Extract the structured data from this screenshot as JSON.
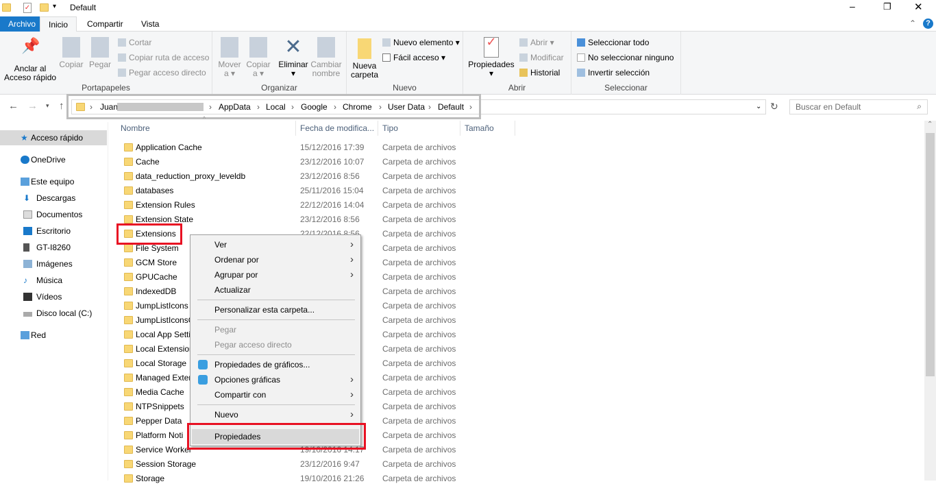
{
  "window": {
    "title": "Default",
    "help": "?"
  },
  "tabs": [
    "Archivo",
    "Inicio",
    "Compartir",
    "Vista"
  ],
  "ribbon": {
    "portapapeles": {
      "label": "Portapapeles",
      "anclar": "Anclar al\nAcceso rápido",
      "copiar": "Copiar",
      "pegar": "Pegar",
      "cortar": "Cortar",
      "copiar_ruta": "Copiar ruta de acceso",
      "pegar_acceso": "Pegar acceso directo"
    },
    "organizar": {
      "label": "Organizar",
      "mover": "Mover\na ▾",
      "copiar_a": "Copiar\na ▾",
      "eliminar": "Eliminar\n▾",
      "cambiar": "Cambiar\nnombre"
    },
    "nuevo": {
      "label": "Nuevo",
      "carpeta": "Nueva\ncarpeta",
      "elemento": "Nuevo elemento ▾",
      "facil": "Fácil acceso ▾"
    },
    "abrir": {
      "label": "Abrir",
      "propiedades": "Propiedades\n▾",
      "abrir": "Abrir ▾",
      "modificar": "Modificar",
      "historial": "Historial"
    },
    "seleccionar": {
      "label": "Seleccionar",
      "todo": "Seleccionar todo",
      "ninguno": "No seleccionar ninguno",
      "invertir": "Invertir selección"
    }
  },
  "address": {
    "crumbs": [
      "Juan",
      "AppData",
      "Local",
      "Google",
      "Chrome",
      "User Data",
      "Default"
    ]
  },
  "search": {
    "placeholder": "Buscar en Default"
  },
  "nav": [
    "Acceso rápido",
    "OneDrive",
    "Este equipo",
    "Descargas",
    "Documentos",
    "Escritorio",
    "GT-I8260",
    "Imágenes",
    "Música",
    "Vídeos",
    "Disco local (C:)",
    "Red"
  ],
  "columns": [
    "Nombre",
    "Fecha de modifica...",
    "Tipo",
    "Tamaño"
  ],
  "files": [
    {
      "n": "Application Cache",
      "d": "15/12/2016 17:39",
      "t": "Carpeta de archivos"
    },
    {
      "n": "Cache",
      "d": "23/12/2016 10:07",
      "t": "Carpeta de archivos"
    },
    {
      "n": "data_reduction_proxy_leveldb",
      "d": "23/12/2016 8:56",
      "t": "Carpeta de archivos"
    },
    {
      "n": "databases",
      "d": "25/11/2016 15:04",
      "t": "Carpeta de archivos"
    },
    {
      "n": "Extension Rules",
      "d": "22/12/2016 14:04",
      "t": "Carpeta de archivos"
    },
    {
      "n": "Extension State",
      "d": "23/12/2016 8:56",
      "t": "Carpeta de archivos"
    },
    {
      "n": "Extensions",
      "d": "22/12/2016 8:56",
      "t": "Carpeta de archivos"
    },
    {
      "n": "File System",
      "d": "",
      "t": "Carpeta de archivos"
    },
    {
      "n": "GCM Store",
      "d": "",
      "t": "Carpeta de archivos"
    },
    {
      "n": "GPUCache",
      "d": "",
      "t": "Carpeta de archivos"
    },
    {
      "n": "IndexedDB",
      "d": "",
      "t": "Carpeta de archivos"
    },
    {
      "n": "JumpListIcons",
      "d": "",
      "t": "Carpeta de archivos"
    },
    {
      "n": "JumpListIconsO",
      "d": "",
      "t": "Carpeta de archivos"
    },
    {
      "n": "Local App Setti",
      "d": "",
      "t": "Carpeta de archivos"
    },
    {
      "n": "Local Extension",
      "d": "",
      "t": "Carpeta de archivos"
    },
    {
      "n": "Local Storage",
      "d": "",
      "t": "Carpeta de archivos"
    },
    {
      "n": "Managed Exter",
      "d": "",
      "t": "Carpeta de archivos"
    },
    {
      "n": "Media Cache",
      "d": "",
      "t": "Carpeta de archivos"
    },
    {
      "n": "NTPSnippets",
      "d": "",
      "t": "Carpeta de archivos"
    },
    {
      "n": "Pepper Data",
      "d": "",
      "t": "Carpeta de archivos"
    },
    {
      "n": "Platform Noti",
      "d": "",
      "t": "Carpeta de archivos"
    },
    {
      "n": "Service Worker",
      "d": "19/10/2016 14:17",
      "t": "Carpeta de archivos"
    },
    {
      "n": "Session Storage",
      "d": "23/12/2016 9:47",
      "t": "Carpeta de archivos"
    },
    {
      "n": "Storage",
      "d": "19/10/2016 21:26",
      "t": "Carpeta de archivos"
    }
  ],
  "context_menu": [
    {
      "label": "Ver",
      "sub": true
    },
    {
      "label": "Ordenar por",
      "sub": true
    },
    {
      "label": "Agrupar por",
      "sub": true
    },
    {
      "label": "Actualizar"
    },
    {
      "sep": true
    },
    {
      "label": "Personalizar esta carpeta..."
    },
    {
      "sep": true
    },
    {
      "label": "Pegar",
      "disabled": true
    },
    {
      "label": "Pegar acceso directo",
      "disabled": true
    },
    {
      "sep": true
    },
    {
      "label": "Propiedades de gráficos...",
      "icon": "graphics-icon"
    },
    {
      "label": "Opciones gráficas",
      "icon": "graphics-icon",
      "sub": true
    },
    {
      "label": "Compartir con",
      "sub": true
    },
    {
      "sep": true
    },
    {
      "label": "Nuevo",
      "sub": true
    },
    {
      "sep": true
    },
    {
      "label": "Propiedades",
      "highlighted": true
    }
  ],
  "colors": {
    "accent": "#1979ca",
    "highlight": "#e81123"
  }
}
